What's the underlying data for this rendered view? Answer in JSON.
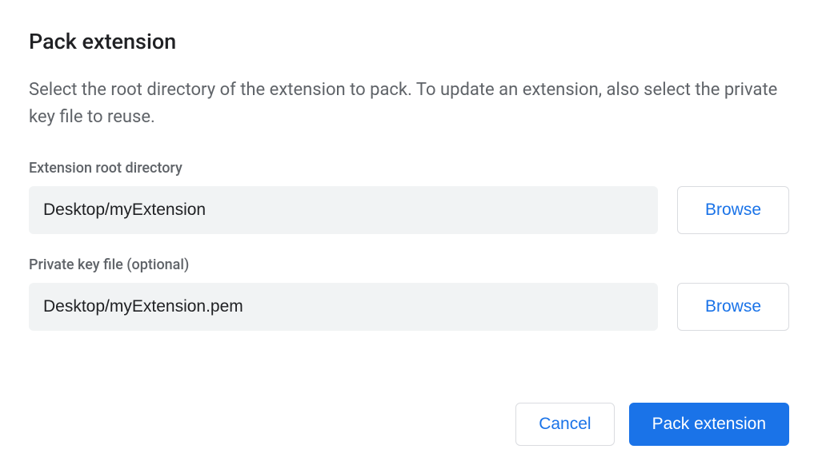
{
  "dialog": {
    "title": "Pack extension",
    "description": "Select the root directory of the extension to pack. To update an extension, also select the private key file to reuse.",
    "fields": {
      "rootDirectory": {
        "label": "Extension root directory",
        "value": "Desktop/myExtension",
        "browseLabel": "Browse"
      },
      "privateKey": {
        "label": "Private key file (optional)",
        "value": "Desktop/myExtension.pem",
        "browseLabel": "Browse"
      }
    },
    "footer": {
      "cancelLabel": "Cancel",
      "confirmLabel": "Pack extension"
    }
  },
  "colors": {
    "accent": "#1a73e8",
    "textPrimary": "#202124",
    "textSecondary": "#5f6368",
    "inputBg": "#f1f3f4",
    "border": "#dadce0"
  }
}
